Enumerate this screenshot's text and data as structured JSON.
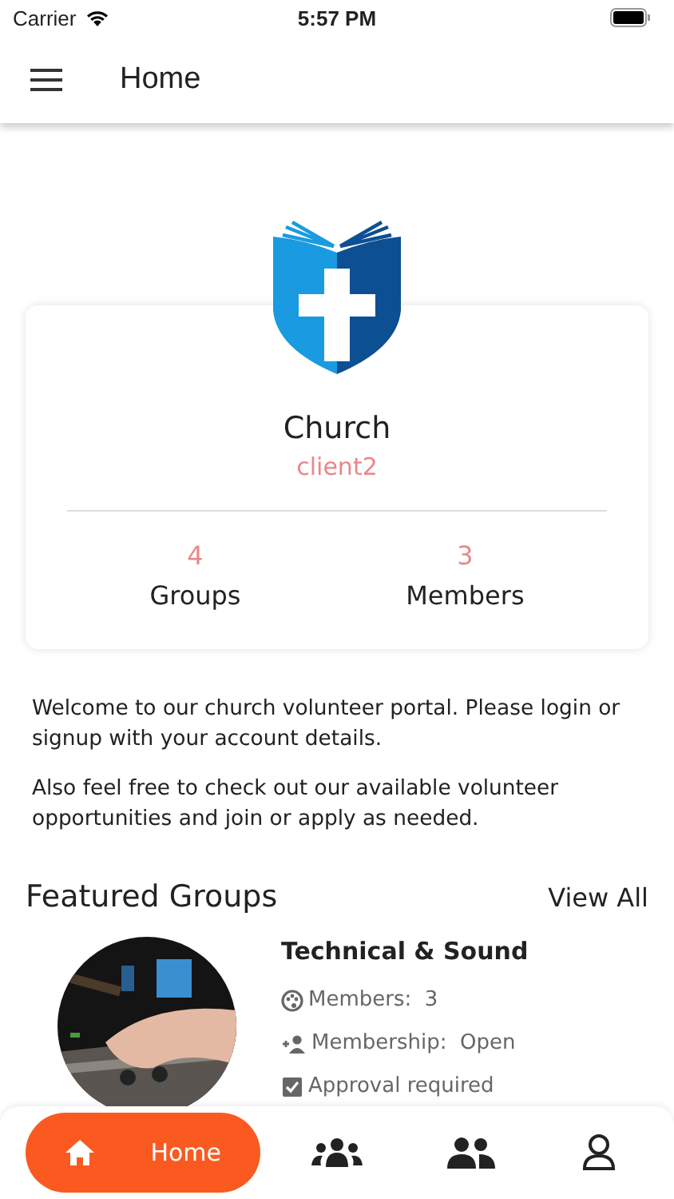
{
  "status_bar": {
    "carrier": "Carrier",
    "time": "5:57 PM"
  },
  "header": {
    "title": "Home"
  },
  "church": {
    "name": "Church",
    "client": "client2",
    "stats": [
      {
        "value": "4",
        "label": "Groups"
      },
      {
        "value": "3",
        "label": "Members"
      }
    ]
  },
  "intro": [
    "Welcome to our church volunteer portal. Please login or signup with your account details.",
    "Also feel free to check out our available volunteer opportunities and join or apply as needed."
  ],
  "featured": {
    "title": "Featured Groups",
    "view_all": "View All",
    "groups": [
      {
        "name": "Technical & Sound",
        "details": [
          {
            "kind": "members",
            "label": "Members:",
            "value": "3"
          },
          {
            "kind": "membership",
            "label": "Membership:",
            "value": "Open"
          },
          {
            "kind": "approval",
            "label": "Approval required"
          }
        ]
      }
    ]
  },
  "nav": [
    {
      "kind": "home",
      "label": "Home",
      "selected": true
    },
    {
      "kind": "groups",
      "selected": false
    },
    {
      "kind": "members",
      "selected": false
    },
    {
      "kind": "profile",
      "selected": false
    }
  ]
}
